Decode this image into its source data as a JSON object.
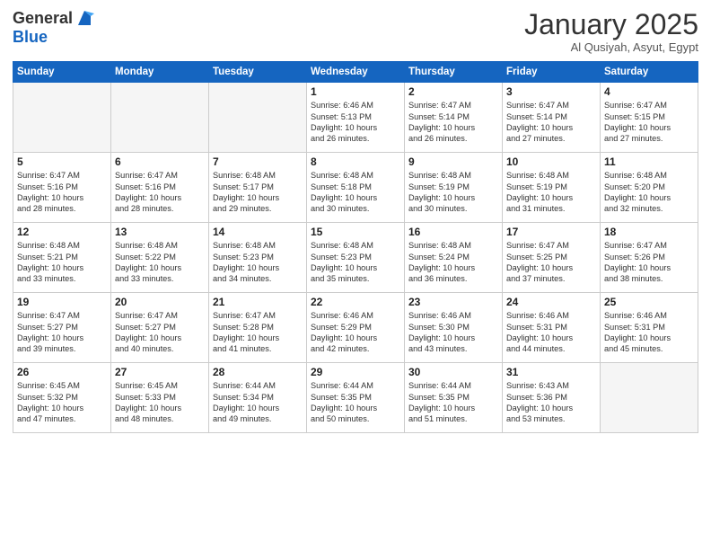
{
  "logo": {
    "general": "General",
    "blue": "Blue"
  },
  "header": {
    "month": "January 2025",
    "location": "Al Qusiyah, Asyut, Egypt"
  },
  "weekdays": [
    "Sunday",
    "Monday",
    "Tuesday",
    "Wednesday",
    "Thursday",
    "Friday",
    "Saturday"
  ],
  "weeks": [
    [
      {
        "day": "",
        "info": ""
      },
      {
        "day": "",
        "info": ""
      },
      {
        "day": "",
        "info": ""
      },
      {
        "day": "1",
        "info": "Sunrise: 6:46 AM\nSunset: 5:13 PM\nDaylight: 10 hours\nand 26 minutes."
      },
      {
        "day": "2",
        "info": "Sunrise: 6:47 AM\nSunset: 5:14 PM\nDaylight: 10 hours\nand 26 minutes."
      },
      {
        "day": "3",
        "info": "Sunrise: 6:47 AM\nSunset: 5:14 PM\nDaylight: 10 hours\nand 27 minutes."
      },
      {
        "day": "4",
        "info": "Sunrise: 6:47 AM\nSunset: 5:15 PM\nDaylight: 10 hours\nand 27 minutes."
      }
    ],
    [
      {
        "day": "5",
        "info": "Sunrise: 6:47 AM\nSunset: 5:16 PM\nDaylight: 10 hours\nand 28 minutes."
      },
      {
        "day": "6",
        "info": "Sunrise: 6:47 AM\nSunset: 5:16 PM\nDaylight: 10 hours\nand 28 minutes."
      },
      {
        "day": "7",
        "info": "Sunrise: 6:48 AM\nSunset: 5:17 PM\nDaylight: 10 hours\nand 29 minutes."
      },
      {
        "day": "8",
        "info": "Sunrise: 6:48 AM\nSunset: 5:18 PM\nDaylight: 10 hours\nand 30 minutes."
      },
      {
        "day": "9",
        "info": "Sunrise: 6:48 AM\nSunset: 5:19 PM\nDaylight: 10 hours\nand 30 minutes."
      },
      {
        "day": "10",
        "info": "Sunrise: 6:48 AM\nSunset: 5:19 PM\nDaylight: 10 hours\nand 31 minutes."
      },
      {
        "day": "11",
        "info": "Sunrise: 6:48 AM\nSunset: 5:20 PM\nDaylight: 10 hours\nand 32 minutes."
      }
    ],
    [
      {
        "day": "12",
        "info": "Sunrise: 6:48 AM\nSunset: 5:21 PM\nDaylight: 10 hours\nand 33 minutes."
      },
      {
        "day": "13",
        "info": "Sunrise: 6:48 AM\nSunset: 5:22 PM\nDaylight: 10 hours\nand 33 minutes."
      },
      {
        "day": "14",
        "info": "Sunrise: 6:48 AM\nSunset: 5:23 PM\nDaylight: 10 hours\nand 34 minutes."
      },
      {
        "day": "15",
        "info": "Sunrise: 6:48 AM\nSunset: 5:23 PM\nDaylight: 10 hours\nand 35 minutes."
      },
      {
        "day": "16",
        "info": "Sunrise: 6:48 AM\nSunset: 5:24 PM\nDaylight: 10 hours\nand 36 minutes."
      },
      {
        "day": "17",
        "info": "Sunrise: 6:47 AM\nSunset: 5:25 PM\nDaylight: 10 hours\nand 37 minutes."
      },
      {
        "day": "18",
        "info": "Sunrise: 6:47 AM\nSunset: 5:26 PM\nDaylight: 10 hours\nand 38 minutes."
      }
    ],
    [
      {
        "day": "19",
        "info": "Sunrise: 6:47 AM\nSunset: 5:27 PM\nDaylight: 10 hours\nand 39 minutes."
      },
      {
        "day": "20",
        "info": "Sunrise: 6:47 AM\nSunset: 5:27 PM\nDaylight: 10 hours\nand 40 minutes."
      },
      {
        "day": "21",
        "info": "Sunrise: 6:47 AM\nSunset: 5:28 PM\nDaylight: 10 hours\nand 41 minutes."
      },
      {
        "day": "22",
        "info": "Sunrise: 6:46 AM\nSunset: 5:29 PM\nDaylight: 10 hours\nand 42 minutes."
      },
      {
        "day": "23",
        "info": "Sunrise: 6:46 AM\nSunset: 5:30 PM\nDaylight: 10 hours\nand 43 minutes."
      },
      {
        "day": "24",
        "info": "Sunrise: 6:46 AM\nSunset: 5:31 PM\nDaylight: 10 hours\nand 44 minutes."
      },
      {
        "day": "25",
        "info": "Sunrise: 6:46 AM\nSunset: 5:31 PM\nDaylight: 10 hours\nand 45 minutes."
      }
    ],
    [
      {
        "day": "26",
        "info": "Sunrise: 6:45 AM\nSunset: 5:32 PM\nDaylight: 10 hours\nand 47 minutes."
      },
      {
        "day": "27",
        "info": "Sunrise: 6:45 AM\nSunset: 5:33 PM\nDaylight: 10 hours\nand 48 minutes."
      },
      {
        "day": "28",
        "info": "Sunrise: 6:44 AM\nSunset: 5:34 PM\nDaylight: 10 hours\nand 49 minutes."
      },
      {
        "day": "29",
        "info": "Sunrise: 6:44 AM\nSunset: 5:35 PM\nDaylight: 10 hours\nand 50 minutes."
      },
      {
        "day": "30",
        "info": "Sunrise: 6:44 AM\nSunset: 5:35 PM\nDaylight: 10 hours\nand 51 minutes."
      },
      {
        "day": "31",
        "info": "Sunrise: 6:43 AM\nSunset: 5:36 PM\nDaylight: 10 hours\nand 53 minutes."
      },
      {
        "day": "",
        "info": ""
      }
    ]
  ]
}
